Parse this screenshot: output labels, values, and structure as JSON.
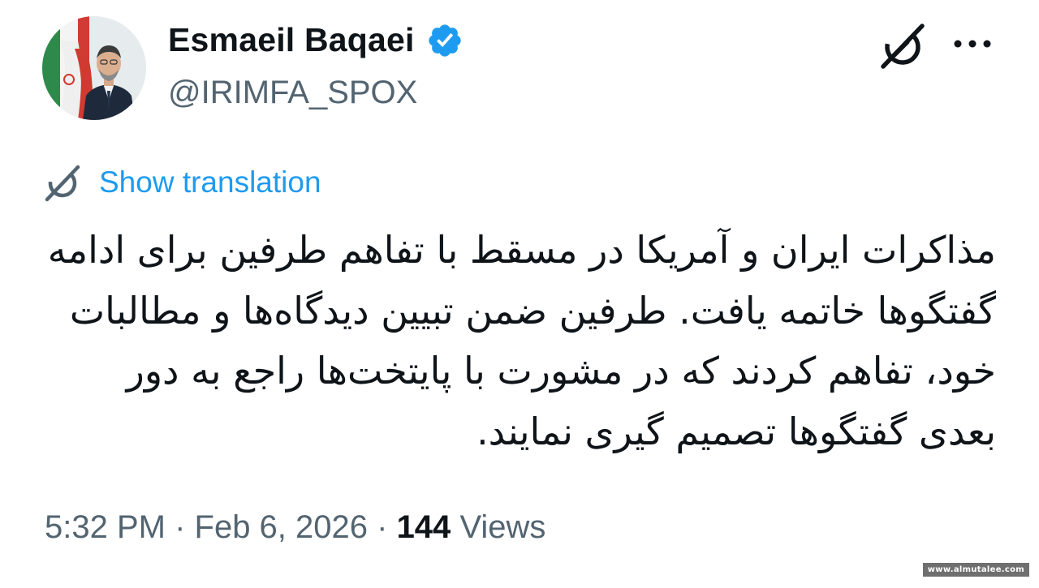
{
  "author": {
    "display_name": "Esmaeil Baqaei",
    "handle": "@IRIMFA_SPOX",
    "verified": true,
    "verified_color": "#1d9bf0"
  },
  "header": {
    "grok_icon": "grok-icon",
    "more_icon": "more-dots-icon"
  },
  "translation": {
    "icon": "grok-translate-icon",
    "label": "Show translation",
    "color": "#1d9bf0"
  },
  "tweet": {
    "text": "مذاکرات ایران و آمریکا در مسقط با تفاهم طرفین برای ادامه گفتگوها خاتمه یافت. طرفین ضمن تبیین دیدگاه‌ها و مطالبات خود، تفاهم کردند که در مشورت با پایتخت‌ها راجع به دور بعدی گفتگوها تصمیم گیری نمایند."
  },
  "meta": {
    "time": "5:32 PM",
    "separator": " · ",
    "date": "Feb 6, 2026",
    "views_count": "144",
    "views_label": "Views"
  },
  "watermark": {
    "text": "www.almutalee.com"
  }
}
